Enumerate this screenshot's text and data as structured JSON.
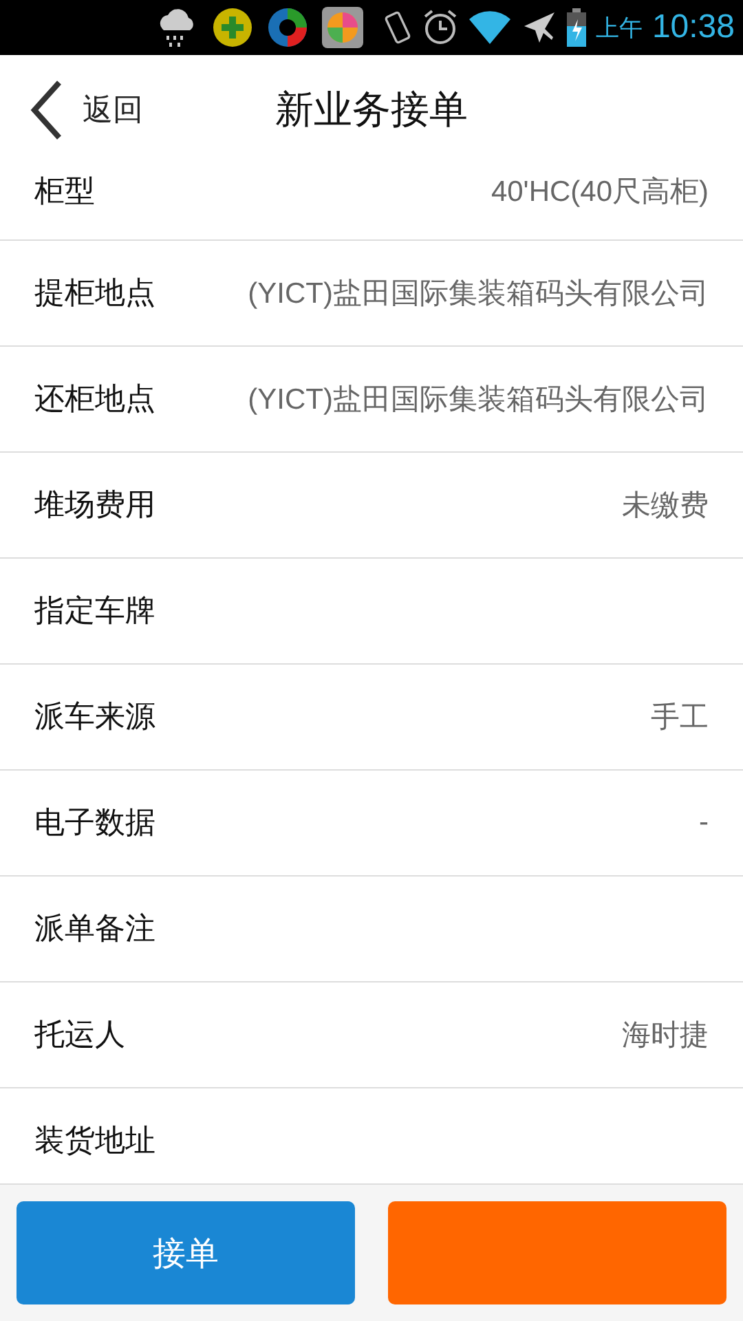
{
  "status_bar": {
    "period": "上午",
    "time": "10:38"
  },
  "header": {
    "back": "返回",
    "title": "新业务接单"
  },
  "rows": [
    {
      "label": "柜型",
      "value": "40'HC(40尺高柜)"
    },
    {
      "label": "提柜地点",
      "value": "(YICT)盐田国际集装箱码头有限公司"
    },
    {
      "label": "还柜地点",
      "value": "(YICT)盐田国际集装箱码头有限公司"
    },
    {
      "label": "堆场费用",
      "value": "未缴费"
    },
    {
      "label": "指定车牌"
    },
    {
      "label": "派车来源",
      "value": "手工"
    },
    {
      "label": "电子数据",
      "value": "-"
    },
    {
      "label": "派单备注"
    },
    {
      "label": "托运人",
      "value": "海时捷"
    },
    {
      "label": "装货地址"
    }
  ],
  "buttons": [
    {
      "label": "接单",
      "color": "#1a87d4"
    },
    {
      "color": "#ff6600"
    }
  ]
}
